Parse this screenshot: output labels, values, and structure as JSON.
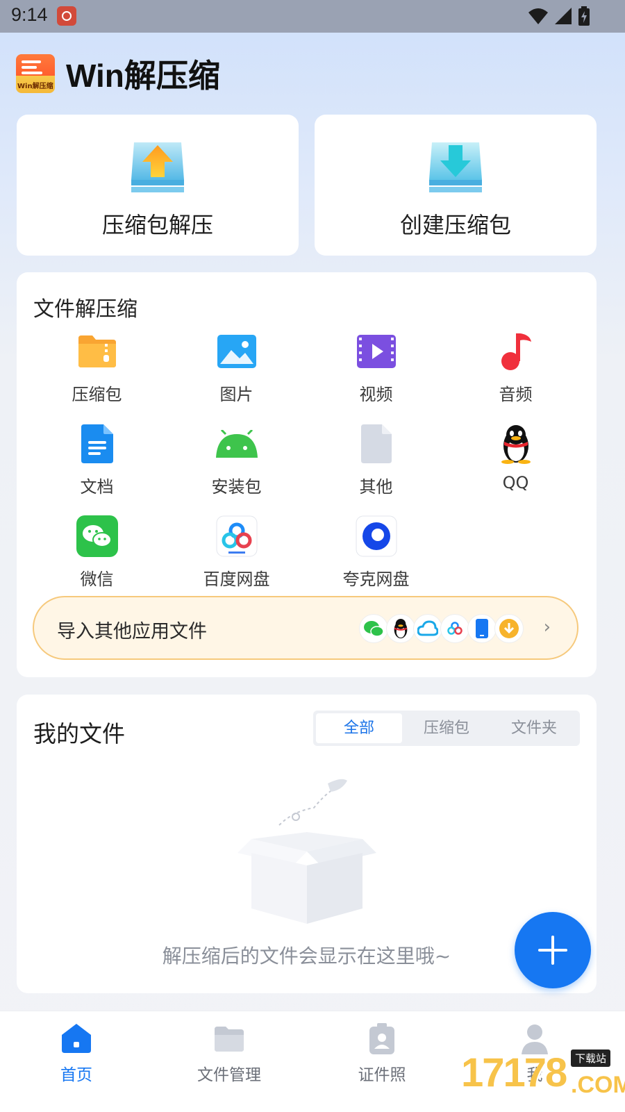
{
  "status_bar": {
    "time": "9:14"
  },
  "app": {
    "title": "Win解压缩",
    "logo_text": "Win解压缩"
  },
  "actions": {
    "extract_label": "压缩包解压",
    "create_label": "创建压缩包"
  },
  "extract_section": {
    "title": "文件解压缩",
    "items": [
      {
        "label": "压缩包",
        "icon": "zip-folder-icon"
      },
      {
        "label": "图片",
        "icon": "image-icon"
      },
      {
        "label": "视频",
        "icon": "video-icon"
      },
      {
        "label": "音频",
        "icon": "music-note-icon"
      },
      {
        "label": "文档",
        "icon": "document-icon"
      },
      {
        "label": "安装包",
        "icon": "android-icon"
      },
      {
        "label": "其他",
        "icon": "file-icon"
      },
      {
        "label": "QQ",
        "icon": "qq-penguin-icon"
      },
      {
        "label": "微信",
        "icon": "wechat-icon"
      },
      {
        "label": "百度网盘",
        "icon": "baidu-netdisk-icon"
      },
      {
        "label": "夸克网盘",
        "icon": "quark-netdisk-icon"
      }
    ],
    "import_bar": {
      "label": "导入其他应用文件",
      "app_icons": [
        "wechat-icon",
        "qq-penguin-icon",
        "cloud-icon",
        "baidu-netdisk-icon",
        "phone-icon",
        "download-icon"
      ]
    }
  },
  "my_files": {
    "title": "我的文件",
    "tabs": [
      {
        "label": "全部",
        "active": true
      },
      {
        "label": "压缩包",
        "active": false
      },
      {
        "label": "文件夹",
        "active": false
      }
    ],
    "empty_text": "解压缩后的文件会显示在这里哦~"
  },
  "bottom_nav": [
    {
      "label": "首页",
      "icon": "home-icon",
      "active": true
    },
    {
      "label": "文件管理",
      "icon": "folder-icon",
      "active": false
    },
    {
      "label": "证件照",
      "icon": "id-photo-icon",
      "active": false
    },
    {
      "label": "我",
      "icon": "profile-icon",
      "active": false
    }
  ],
  "watermark": {
    "number": "17178",
    "tag": "下载站",
    "suffix": ".COM"
  },
  "colors": {
    "accent": "#1677f2",
    "import_bar_bg": "#fff6e6",
    "import_bar_border": "#f6c97c"
  }
}
